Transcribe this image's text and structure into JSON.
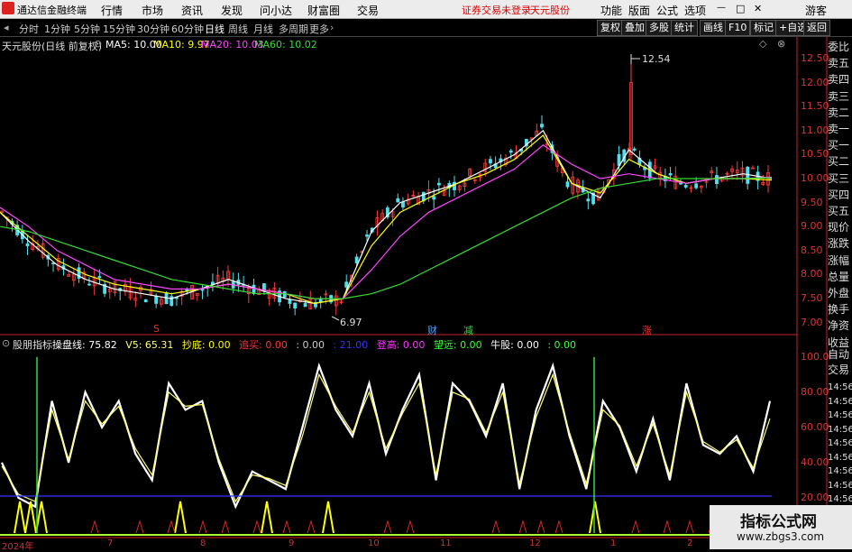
{
  "menubar": {
    "app_title": "通达信金融终端",
    "items": [
      "行情",
      "市场",
      "资讯",
      "发现",
      "问小达",
      "财富圈",
      "交易"
    ],
    "notice": "证券交易未登录",
    "stock_name": "天元股份",
    "right_items": [
      "功能",
      "版面",
      "公式",
      "选项"
    ],
    "guest": "游客",
    "win_controls": [
      "—",
      "□",
      "✕"
    ]
  },
  "periodbar": {
    "periods": [
      "分时",
      "1分钟",
      "5分钟",
      "15分钟",
      "30分钟",
      "60分钟",
      "日线",
      "周线",
      "月线",
      "多周期",
      "更多"
    ],
    "active": "日线",
    "tools": [
      "复权",
      "叠加",
      "多股",
      "统计",
      "画线",
      "F10",
      "标记",
      "+自选",
      "返回"
    ]
  },
  "main_chart": {
    "title": "天元股份(日线 前复权)",
    "ma": [
      {
        "label": "MA5: 10.00",
        "color": "#ffffff"
      },
      {
        "label": "MA10: 9.97",
        "color": "#ffff00"
      },
      {
        "label": "MA20: 10.03",
        "color": "#ff44ff"
      },
      {
        "label": "MA60: 10.02",
        "color": "#33dd33"
      }
    ],
    "high_label": "12.54",
    "low_label": "6.97",
    "markers": [
      "S",
      "财",
      "减",
      "涨"
    ]
  },
  "indicator": {
    "title": "股朋指标",
    "items": [
      {
        "label": "操盘线: 75.82",
        "color": "#ffffff"
      },
      {
        "label": "V5: 65.31",
        "color": "#ffff66"
      },
      {
        "label": "抄底: 0.00",
        "color": "#ffff00"
      },
      {
        "label": "追买: 0.00",
        "color": "#ff3333"
      },
      {
        "label": ": 0.00",
        "color": "#cccccc"
      },
      {
        "label": ": 21.00",
        "color": "#3333ff"
      },
      {
        "label": "登高: 0.00",
        "color": "#ff33ff"
      },
      {
        "label": "望远: 0.00",
        "color": "#33ff33"
      },
      {
        "label": "牛股: 0.00",
        "color": "#ffffff"
      },
      {
        "label": ": 0.00",
        "color": "#33ff33"
      }
    ]
  },
  "right_panel": {
    "labels": [
      "委比",
      "卖五",
      "卖四",
      "卖三",
      "卖二",
      "卖一",
      "买一",
      "买二",
      "买三",
      "买四",
      "买五",
      "现价",
      "涨跌",
      "涨幅",
      "总量",
      "外盘",
      "换手",
      "净资",
      "收益"
    ],
    "auto_trade": [
      "自动",
      "交易"
    ],
    "times": [
      "14:56",
      "14:56",
      "14:56",
      "14:56",
      "14:56",
      "14:56",
      "14:56",
      "14:56",
      "14:56",
      "14:56"
    ]
  },
  "x_axis": [
    "2024年",
    "7",
    "8",
    "9",
    "10",
    "11",
    "12",
    "1",
    "2"
  ],
  "watermark": {
    "title": "指标公式网",
    "url": "www.zbgs3.com"
  },
  "chart_data": [
    {
      "type": "candlestick",
      "title": "天元股份(日线 前复权)",
      "y_ticks": [
        "12.50",
        "12.00",
        "11.50",
        "11.00",
        "10.50",
        "10.00",
        "9.50",
        "9.00",
        "8.50",
        "8.00",
        "7.50",
        "7.00"
      ],
      "ylim": [
        6.9,
        12.8
      ],
      "series": [
        {
          "name": "MA5",
          "color": "#ffffff",
          "values": [
            9.3,
            8.7,
            8.2,
            7.9,
            7.7,
            7.6,
            7.5,
            7.7,
            7.9,
            7.7,
            7.5,
            7.4,
            7.5,
            8.9,
            9.5,
            9.7,
            9.9,
            10.2,
            10.5,
            11.0,
            9.9,
            9.6,
            10.6,
            10.1,
            9.9,
            10.0,
            10.1,
            10.0
          ]
        },
        {
          "name": "MA10",
          "color": "#ffff00",
          "values": [
            9.3,
            8.8,
            8.3,
            8.0,
            7.8,
            7.7,
            7.6,
            7.7,
            7.8,
            7.7,
            7.6,
            7.4,
            7.5,
            8.6,
            9.3,
            9.6,
            9.9,
            10.1,
            10.4,
            10.9,
            9.9,
            9.7,
            10.4,
            10.1,
            9.9,
            10.0,
            10.0,
            9.97
          ]
        },
        {
          "name": "MA20",
          "color": "#ff44ff",
          "values": [
            9.4,
            9.0,
            8.5,
            8.2,
            7.9,
            7.8,
            7.7,
            7.7,
            7.8,
            7.7,
            7.6,
            7.5,
            7.5,
            8.1,
            8.8,
            9.3,
            9.6,
            9.9,
            10.2,
            10.7,
            10.3,
            10.0,
            10.1,
            10.0,
            9.9,
            10.0,
            10.0,
            10.03
          ]
        },
        {
          "name": "MA60",
          "color": "#33dd33",
          "values": [
            9.0,
            8.9,
            8.7,
            8.5,
            8.3,
            8.1,
            7.9,
            7.8,
            7.7,
            7.6,
            7.6,
            7.5,
            7.5,
            7.6,
            7.8,
            8.1,
            8.4,
            8.7,
            9.0,
            9.3,
            9.6,
            9.8,
            9.9,
            10.0,
            10.0,
            10.0,
            10.0,
            10.02
          ]
        }
      ]
    },
    {
      "type": "line",
      "title": "股朋指标",
      "y_ticks": [
        "100.0",
        "80.00",
        "60.00",
        "40.00",
        "20.00"
      ],
      "ylim": [
        0,
        105
      ],
      "series": [
        {
          "name": "操盘线",
          "color": "#ffffff",
          "values": [
            40,
            20,
            15,
            75,
            40,
            80,
            60,
            75,
            45,
            30,
            85,
            70,
            75,
            40,
            15,
            35,
            30,
            25,
            60,
            95,
            70,
            55,
            85,
            45,
            70,
            90,
            30,
            85,
            75,
            55,
            85,
            25,
            70,
            95,
            55,
            25,
            75,
            60,
            35,
            65,
            30,
            85,
            50,
            45,
            55,
            35,
            75
          ]
        },
        {
          "name": "V5",
          "color": "#ffff66",
          "values": [
            38,
            22,
            18,
            70,
            42,
            75,
            62,
            72,
            48,
            33,
            80,
            72,
            73,
            42,
            18,
            33,
            31,
            27,
            55,
            90,
            72,
            57,
            80,
            48,
            68,
            85,
            33,
            80,
            76,
            57,
            80,
            28,
            66,
            90,
            57,
            28,
            70,
            61,
            38,
            62,
            33,
            80,
            52,
            46,
            53,
            37,
            65
          ]
        },
        {
          "name": "辅助线",
          "color": "#3333ff",
          "values": [
            21,
            21
          ]
        }
      ]
    }
  ]
}
